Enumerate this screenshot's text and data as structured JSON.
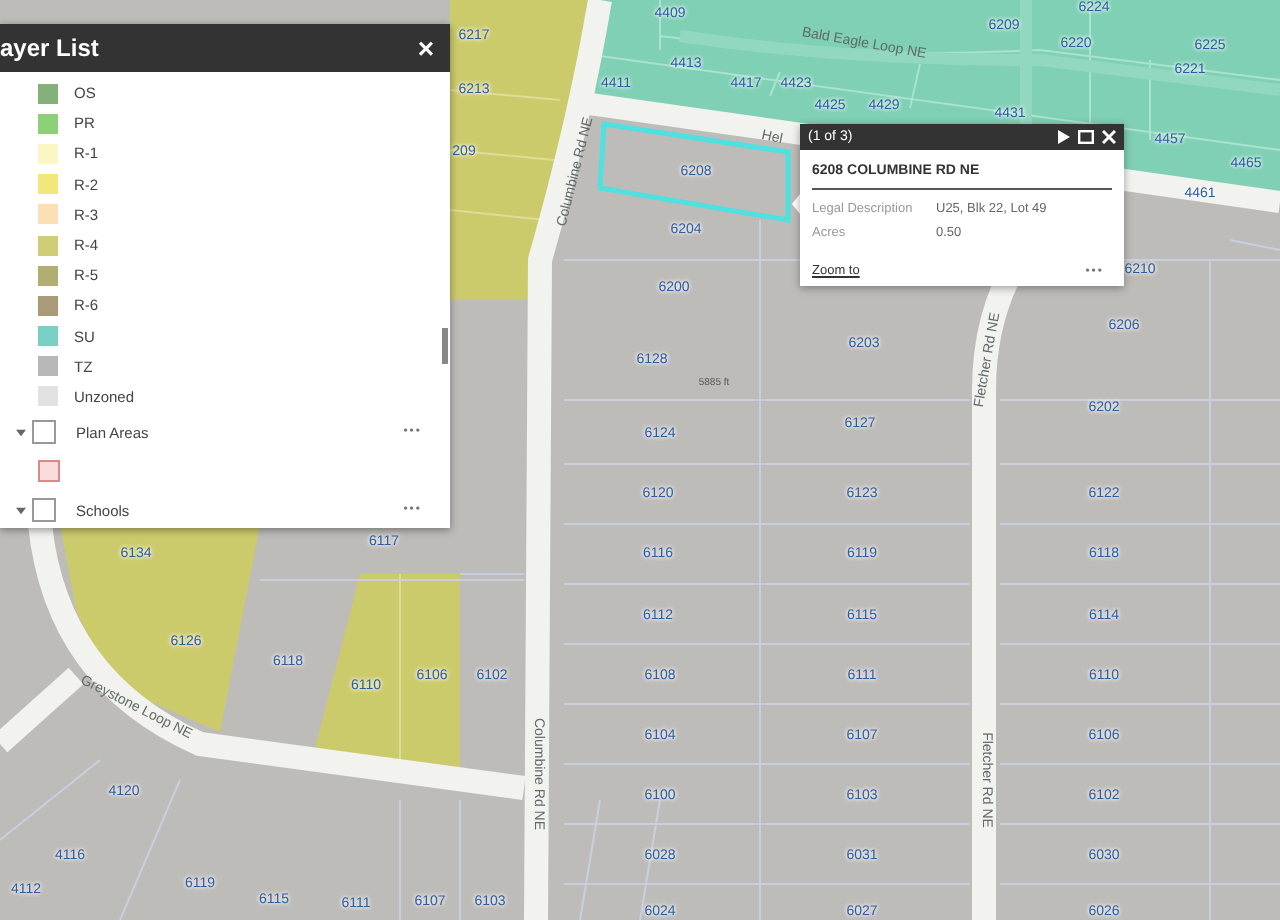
{
  "layer_list": {
    "title": "ayer List",
    "close": "×",
    "legend": [
      {
        "label": "OS",
        "color": "#86b07a"
      },
      {
        "label": "PR",
        "color": "#8ed07a"
      },
      {
        "label": "R-1",
        "color": "#fbf6c4"
      },
      {
        "label": "R-2",
        "color": "#f3e67a"
      },
      {
        "label": "R-3",
        "color": "#fae0b4"
      },
      {
        "label": "R-4",
        "color": "#cfcd78"
      },
      {
        "label": "R-5",
        "color": "#b1ae72"
      },
      {
        "label": "R-6",
        "color": "#a99a78"
      },
      {
        "label": "SU",
        "color": "#78cfc4"
      },
      {
        "label": "TZ",
        "color": "#b8b8b8"
      },
      {
        "label": "Unzoned",
        "color": "#e2e2e2"
      }
    ],
    "layers": [
      {
        "label": "Plan Areas",
        "checked": false,
        "expanded": true,
        "more": "•••",
        "legend": [
          {
            "color": "#f9dcdc"
          }
        ]
      },
      {
        "label": "Schools",
        "checked": false,
        "expanded": true,
        "more": "•••"
      }
    ]
  },
  "popup": {
    "counter": "(1 of 3)",
    "title": "6208 COLUMBINE RD NE",
    "fields": [
      {
        "label": "Legal Description",
        "value": "U25, Blk 22, Lot 49"
      },
      {
        "label": "Acres",
        "value": "0.50"
      }
    ],
    "link": "Zoom to",
    "more": "•••"
  },
  "map": {
    "labels": [
      {
        "kind": "parcel",
        "text": "4409"
      },
      {
        "kind": "parcel",
        "text": "6217"
      },
      {
        "kind": "parcel",
        "text": "6213"
      },
      {
        "kind": "parcel",
        "text": "209"
      },
      {
        "kind": "parcel",
        "text": "4413"
      },
      {
        "kind": "parcel",
        "text": "4411"
      },
      {
        "kind": "parcel",
        "text": "4417"
      },
      {
        "kind": "parcel",
        "text": "4423"
      },
      {
        "kind": "parcel",
        "text": "4425"
      },
      {
        "kind": "parcel",
        "text": "4429"
      },
      {
        "kind": "parcel",
        "text": "4431"
      },
      {
        "kind": "parcel",
        "text": "6224"
      },
      {
        "kind": "parcel",
        "text": "6209"
      },
      {
        "kind": "parcel",
        "text": "6220"
      },
      {
        "kind": "parcel",
        "text": "6225"
      },
      {
        "kind": "parcel",
        "text": "6221"
      },
      {
        "kind": "parcel",
        "text": "4457"
      },
      {
        "kind": "parcel",
        "text": "4461"
      },
      {
        "kind": "parcel",
        "text": "4465"
      },
      {
        "kind": "parcel",
        "text": "6208"
      },
      {
        "kind": "parcel",
        "text": "6204"
      },
      {
        "kind": "parcel",
        "text": "6200"
      },
      {
        "kind": "parcel",
        "text": "6210"
      },
      {
        "kind": "parcel",
        "text": "6206"
      },
      {
        "kind": "parcel",
        "text": "6203"
      },
      {
        "kind": "parcel",
        "text": "6128"
      },
      {
        "kind": "note",
        "text": "5885 ft"
      },
      {
        "kind": "parcel",
        "text": "6202"
      },
      {
        "kind": "parcel",
        "text": "6124"
      },
      {
        "kind": "parcel",
        "text": "6127"
      },
      {
        "kind": "parcel",
        "text": "6120"
      },
      {
        "kind": "parcel",
        "text": "6123"
      },
      {
        "kind": "parcel",
        "text": "6122"
      },
      {
        "kind": "parcel",
        "text": "6116"
      },
      {
        "kind": "parcel",
        "text": "6119"
      },
      {
        "kind": "parcel",
        "text": "6118"
      },
      {
        "kind": "parcel",
        "text": "6112"
      },
      {
        "kind": "parcel",
        "text": "6115"
      },
      {
        "kind": "parcel",
        "text": "6114"
      },
      {
        "kind": "parcel",
        "text": "6108"
      },
      {
        "kind": "parcel",
        "text": "6111"
      },
      {
        "kind": "parcel",
        "text": "6110"
      },
      {
        "kind": "parcel",
        "text": "6104"
      },
      {
        "kind": "parcel",
        "text": "6107"
      },
      {
        "kind": "parcel",
        "text": "6106"
      },
      {
        "kind": "parcel",
        "text": "6100"
      },
      {
        "kind": "parcel",
        "text": "6103"
      },
      {
        "kind": "parcel",
        "text": "6102"
      },
      {
        "kind": "parcel",
        "text": "6028"
      },
      {
        "kind": "parcel",
        "text": "6031"
      },
      {
        "kind": "parcel",
        "text": "6030"
      },
      {
        "kind": "parcel",
        "text": "6024"
      },
      {
        "kind": "parcel",
        "text": "6027"
      },
      {
        "kind": "parcel",
        "text": "6026"
      },
      {
        "kind": "parcel",
        "text": "6134"
      },
      {
        "kind": "parcel",
        "text": "6117"
      },
      {
        "kind": "parcel",
        "text": "6126"
      },
      {
        "kind": "parcel",
        "text": "6118"
      },
      {
        "kind": "parcel",
        "text": "6110"
      },
      {
        "kind": "parcel",
        "text": "6106"
      },
      {
        "kind": "parcel",
        "text": "6102"
      },
      {
        "kind": "parcel",
        "text": "4120"
      },
      {
        "kind": "parcel",
        "text": "4116"
      },
      {
        "kind": "parcel",
        "text": "4112"
      },
      {
        "kind": "parcel",
        "text": "6119"
      },
      {
        "kind": "parcel",
        "text": "6115"
      },
      {
        "kind": "parcel",
        "text": "6111"
      },
      {
        "kind": "parcel",
        "text": "6107"
      },
      {
        "kind": "parcel",
        "text": "6103"
      },
      {
        "kind": "road",
        "text": "Bald Eagle Loop NE"
      },
      {
        "kind": "road",
        "text": "Columbine Rd NE"
      },
      {
        "kind": "road",
        "text": "Hel"
      },
      {
        "kind": "road",
        "text": "Fletcher Rd NE"
      },
      {
        "kind": "road",
        "text": "Fletcher Rd NE"
      },
      {
        "kind": "road",
        "text": "Greystone Loop NE"
      },
      {
        "kind": "road",
        "text": "Columbine Rd NE"
      }
    ]
  }
}
